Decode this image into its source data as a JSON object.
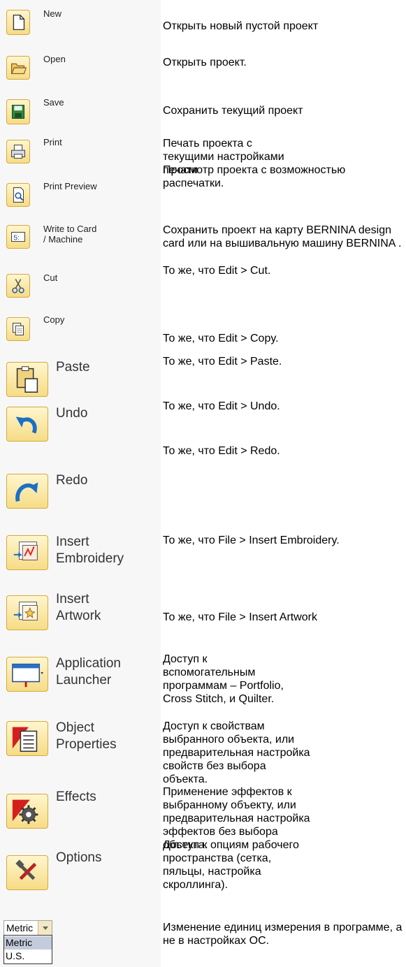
{
  "items": [
    {
      "label": "New",
      "icon": "new-document-icon",
      "description": "Открыть новый пустой проект"
    },
    {
      "label": "Open",
      "icon": "open-folder-icon",
      "description": "Открыть проект."
    },
    {
      "label": "Save",
      "icon": "save-disk-icon",
      "description": "Сохранить текущий проект"
    },
    {
      "label": "Print",
      "icon": "printer-icon",
      "description": "Печать проекта с текущими настройками печати"
    },
    {
      "label": "Print Preview",
      "icon": "print-preview-icon",
      "description": "Просмотр проекта с возможностью распечатки."
    },
    {
      "label": "Write to Card\n/ Machine",
      "icon": "write-to-card-icon",
      "description": "Сохранить проект на карту BERNINA design card или на вышивальную машину BERNINA ."
    },
    {
      "label": "Cut",
      "icon": "scissors-icon",
      "description": "То же, что Edit > Cut."
    },
    {
      "label": "Copy",
      "icon": "copy-icon",
      "description": "То же, что Edit > Copy."
    },
    {
      "label": "Paste",
      "icon": "paste-icon",
      "description": "То же, что Edit > Paste."
    },
    {
      "label": "Undo",
      "icon": "undo-arrow-icon",
      "description": "То же, что Edit > Undo."
    },
    {
      "label": "Redo",
      "icon": "redo-arrow-icon",
      "description": "То же, что Edit > Redo."
    },
    {
      "label": "Insert\nEmbroidery",
      "icon": "insert-embroidery-icon",
      "description": "То же, что File > Insert Embroidery."
    },
    {
      "label": "Insert\nArtwork",
      "icon": "insert-artwork-icon",
      "description": "То же, что File > Insert Artwork"
    },
    {
      "label": "Application\nLauncher",
      "icon": "application-launcher-icon",
      "description": "Доступ к вспомогательным программам  – Portfolio, Cross Stitch, и Quilter."
    },
    {
      "label": "Object\nProperties",
      "icon": "object-properties-icon",
      "description": "Доступ к свойствам выбранного объекта, или  предварительная настройка свойств без выбора объекта."
    },
    {
      "label": "Effects",
      "icon": "effects-gear-icon",
      "description": "Применение эффектов к выбранному объекту, или предварительная настройка эффектов без выбора объекта."
    },
    {
      "label": "Options",
      "icon": "options-tools-icon",
      "description": "Доступ к опциям рабочего пространства (сетка, пяльцы, настройка скроллинга)."
    }
  ],
  "units": {
    "selected": "Metric",
    "options": [
      "Metric",
      "U.S."
    ],
    "description": "Изменение единиц измерения в программе, а не в настройках ОС."
  }
}
